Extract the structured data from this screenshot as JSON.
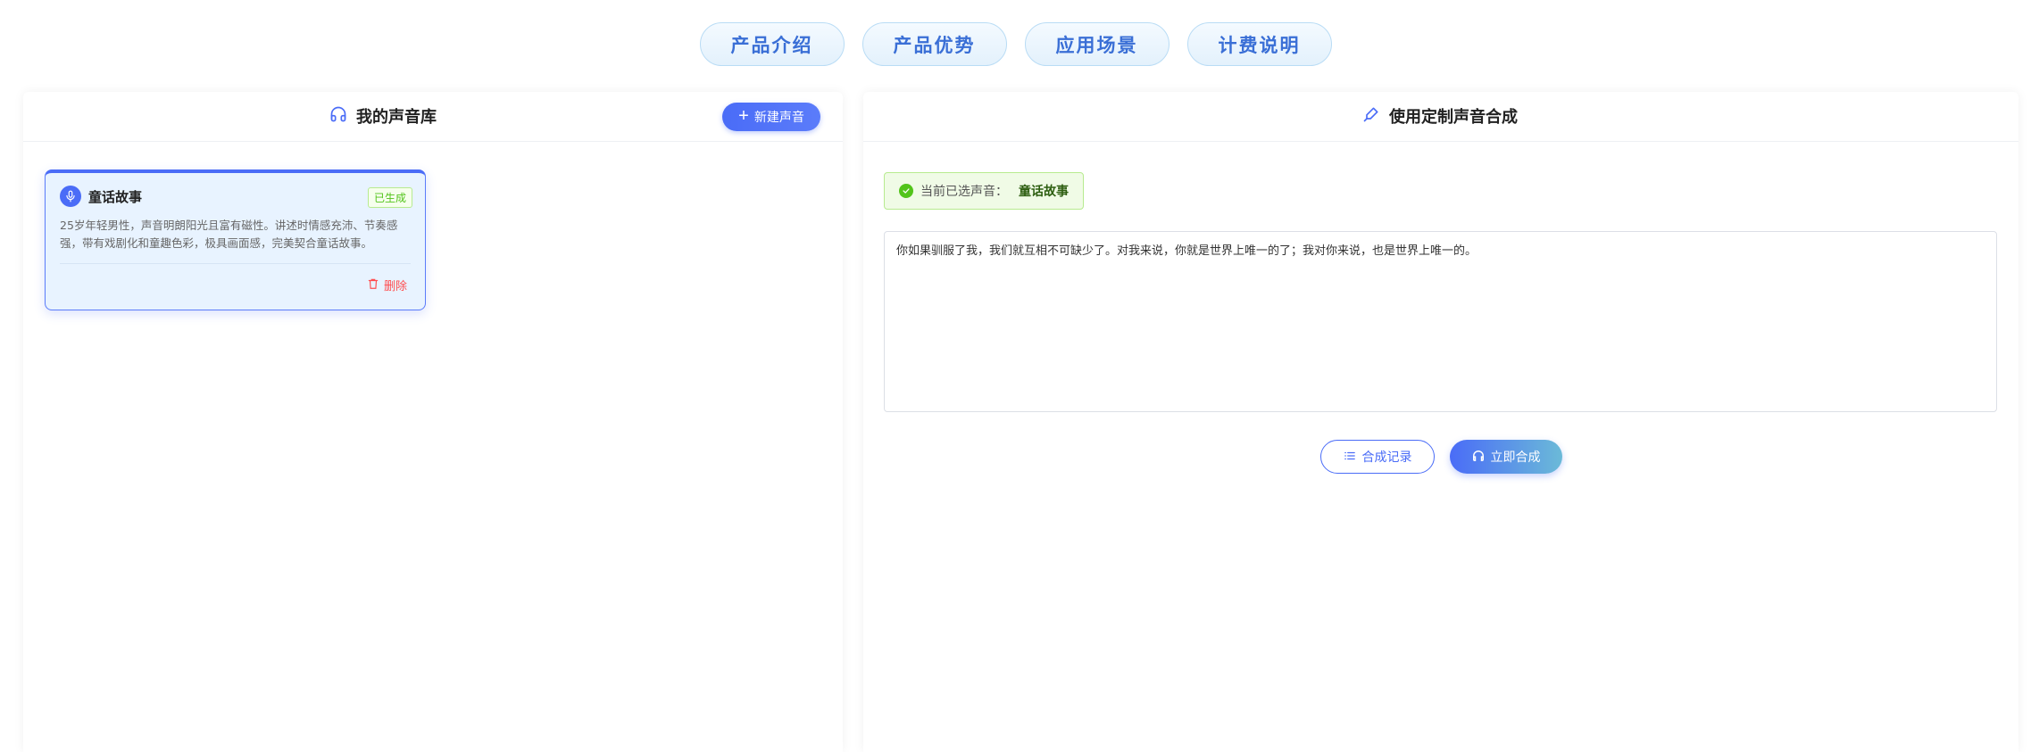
{
  "nav": {
    "items": [
      "产品介绍",
      "产品优势",
      "应用场景",
      "计费说明"
    ]
  },
  "left_panel": {
    "title": "我的声音库",
    "new_voice_label": "新建声音",
    "card": {
      "name": "童话故事",
      "status": "已生成",
      "description": "25岁年轻男性，声音明朗阳光且富有磁性。讲述时情感充沛、节奏感强，带有戏剧化和童趣色彩，极具画面感，完美契合童话故事。",
      "delete_label": "删除"
    }
  },
  "right_panel": {
    "title": "使用定制声音合成",
    "selected_label": "当前已选声音：",
    "selected_voice": "童话故事",
    "text_value": "你如果驯服了我，我们就互相不可缺少了。对我来说，你就是世界上唯一的了；我对你来说，也是世界上唯一的。",
    "history_label": "合成记录",
    "synth_label": "立即合成"
  },
  "colors": {
    "primary": "#4a6cf7",
    "success": "#52c41a",
    "danger": "#ff4d4f",
    "card_bg": "#e8f3ff"
  }
}
